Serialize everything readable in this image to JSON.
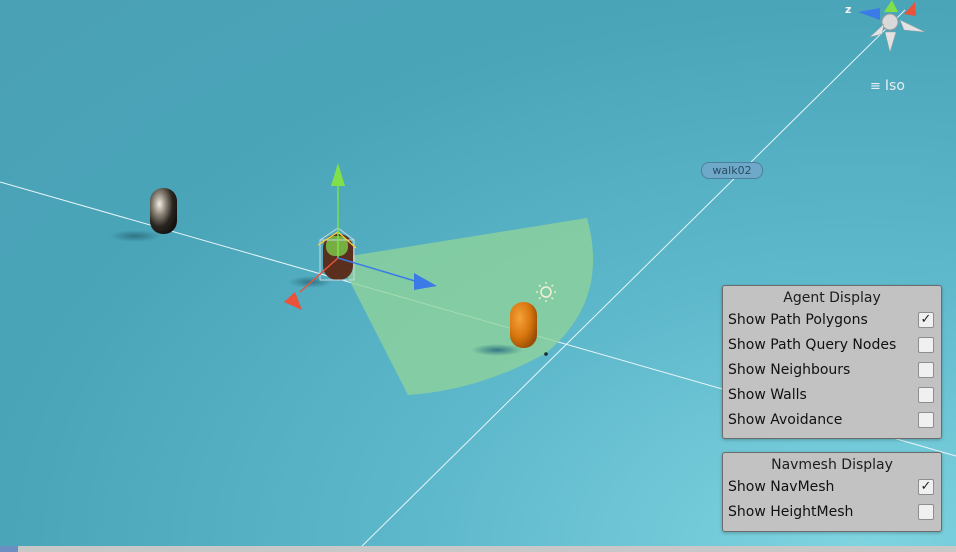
{
  "viewport": {
    "projection_label": "Iso",
    "axis_label_z": "z",
    "object_label": "walk02"
  },
  "agent_display": {
    "title": "Agent Display",
    "options": [
      {
        "label": "Show Path Polygons",
        "checked": true
      },
      {
        "label": "Show Path Query Nodes",
        "checked": false
      },
      {
        "label": "Show Neighbours",
        "checked": false
      },
      {
        "label": "Show Walls",
        "checked": false
      },
      {
        "label": "Show Avoidance",
        "checked": false
      }
    ]
  },
  "navmesh_display": {
    "title": "Navmesh Display",
    "options": [
      {
        "label": "Show NavMesh",
        "checked": true
      },
      {
        "label": "Show HeightMesh",
        "checked": false
      }
    ]
  },
  "colors": {
    "background": "#4aa5b9",
    "panel": "#c2c2c2",
    "view_cone": "#8fd49a",
    "axis_y": "#7fe04a",
    "axis_x": "#e8533a",
    "axis_z": "#3a7be8",
    "capsule_dark": "#1e1a17",
    "capsule_orange": "#e07a12"
  },
  "icons": {
    "checkmark": "✓",
    "menu": "≡"
  }
}
